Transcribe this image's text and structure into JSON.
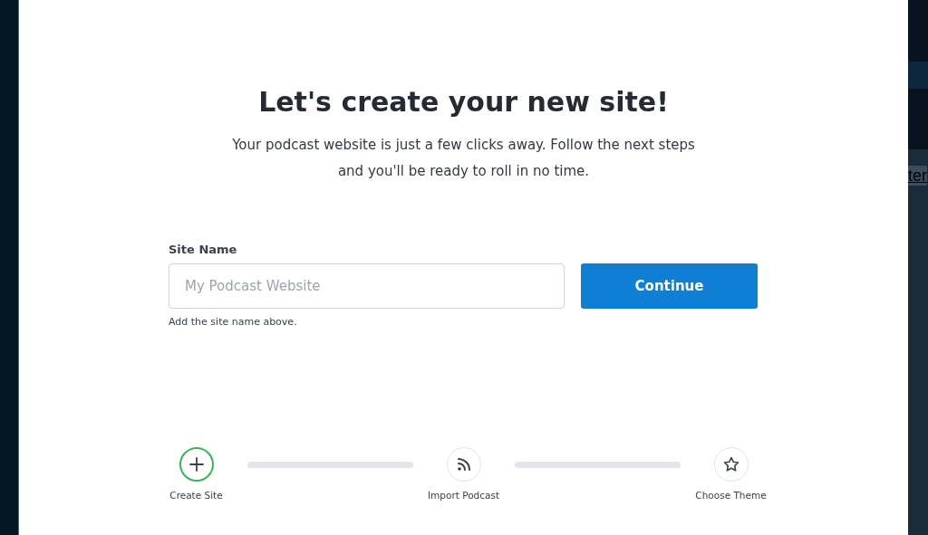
{
  "backdrop": {
    "link": "ter"
  },
  "dialog": {
    "title": "Let's create your new site!",
    "subtitle": "Your podcast website is just a few clicks away. Follow the next steps and you'll be ready to roll in no time.",
    "field": {
      "label": "Site Name",
      "placeholder": "My Podcast Website",
      "help": "Add the site name above."
    },
    "button": "Continue",
    "steps": [
      {
        "label": "Create Site",
        "kind": "plus",
        "active": true
      },
      {
        "label": "Import Podcast",
        "kind": "rss",
        "active": false
      },
      {
        "label": "Choose Theme",
        "kind": "star",
        "active": false
      }
    ]
  }
}
